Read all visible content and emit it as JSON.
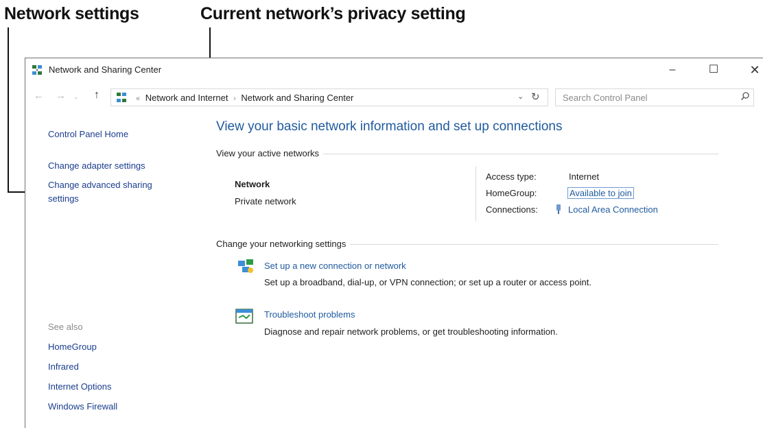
{
  "callouts": {
    "network_settings": "Network settings",
    "privacy_setting": "Current network’s privacy setting"
  },
  "window": {
    "title": "Network and Sharing Center",
    "controls": {
      "minimize": "–",
      "maximize": "☐",
      "close": "✕"
    }
  },
  "nav": {
    "back": "←",
    "forward": "→",
    "recent": "⌄",
    "up": "↑",
    "breadcrumb": {
      "prefix": "«",
      "items": [
        "Network and Internet",
        "Network and Sharing Center"
      ],
      "separator": "›"
    },
    "dropdown": "⌄",
    "refresh": "↻",
    "search_placeholder": "Search Control Panel"
  },
  "sidebar": {
    "home": "Control Panel Home",
    "links": [
      "Change adapter settings",
      "Change advanced sharing",
      "settings"
    ],
    "see_also_heading": "See also",
    "see_also": [
      "HomeGroup",
      "Infrared",
      "Internet Options",
      "Windows Firewall"
    ]
  },
  "main": {
    "title": "View your basic network information and set up connections",
    "active_networks_label": "View your active networks",
    "network_name": "Network",
    "network_type": "Private network",
    "access_type_label": "Access type:",
    "access_type_value": "Internet",
    "homegroup_label": "HomeGroup:",
    "homegroup_value": "Available to join",
    "connections_label": "Connections:",
    "connections_value": "Local Area Connection",
    "change_settings_label": "Change your networking settings",
    "tasks": [
      {
        "link": "Set up a new connection or network",
        "desc": "Set up a broadband, dial-up, or VPN connection; or set up a router or access point."
      },
      {
        "link": "Troubleshoot problems",
        "desc": "Diagnose and repair network problems, or get troubleshooting information."
      }
    ]
  },
  "colors": {
    "link_blue": "#1f5a9e",
    "sidebar_link": "#1a3d8f",
    "rule_gray": "#d9d9d9"
  }
}
